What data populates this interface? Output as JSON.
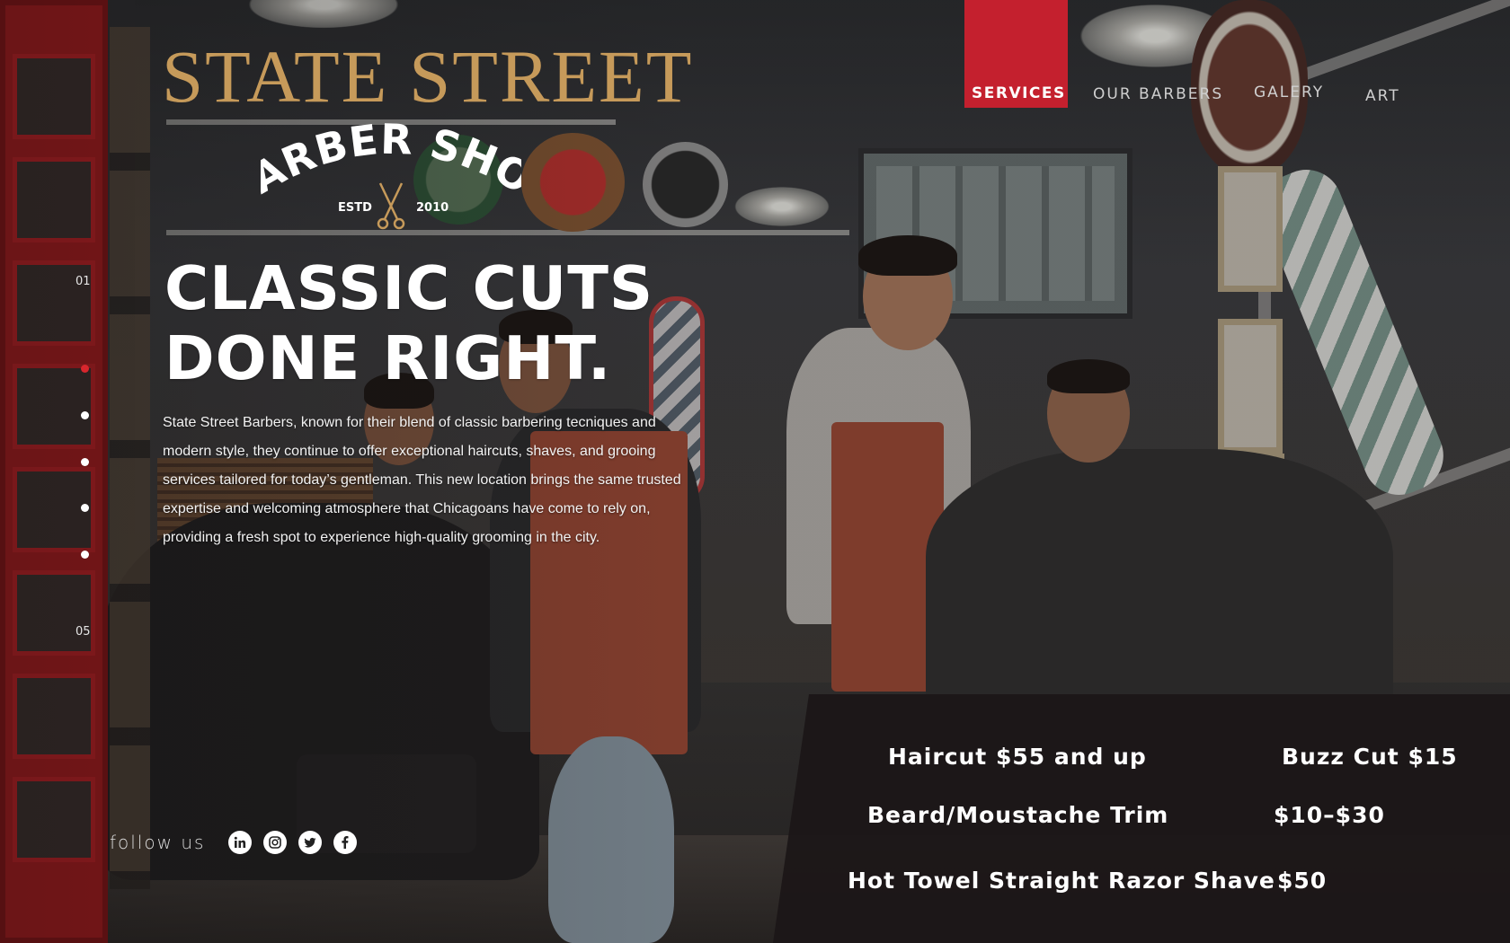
{
  "brand": {
    "name": "STATE STREET",
    "badge_title": "BARBER SHOP",
    "badge_estd": "ESTD",
    "badge_year": "2010"
  },
  "nav": {
    "items": [
      {
        "label": "SERVICES",
        "active": true
      },
      {
        "label": "OUR BARBERS",
        "active": false
      },
      {
        "label": "GALERY",
        "active": false
      },
      {
        "label": "ART",
        "active": false
      }
    ]
  },
  "hero": {
    "title_line1": "CLASSIC CUTS",
    "title_line2": "DONE RIGHT.",
    "description": "State Street Barbers, known for their blend of classic barbering tecniques and modern style, they continue to offer exceptional haircuts, shaves, and grooing services tailored for today’s gentleman. This new location brings the same trusted expertise and welcoming atmosphere that Chicagoans have come to rely on, providing a fresh spot to experience high-quality grooming in the city."
  },
  "pager": {
    "first": "01",
    "last": "05",
    "active_index": 1
  },
  "social": {
    "label": "follow us",
    "icons": [
      "linkedin-icon",
      "instagram-icon",
      "twitter-icon",
      "facebook-icon"
    ]
  },
  "prices": {
    "haircut": "Haircut  $55 and up",
    "buzz": "Buzz Cut  $15",
    "beard_name": "Beard/Moustache Trim",
    "beard_price": "$10–$30",
    "shave_name": "Hot Towel Straight Razor Shave",
    "shave_price": "$50"
  },
  "colors": {
    "gold": "#c69a5a",
    "accent_red": "#c4202e",
    "price_panel": "#1c1718"
  }
}
